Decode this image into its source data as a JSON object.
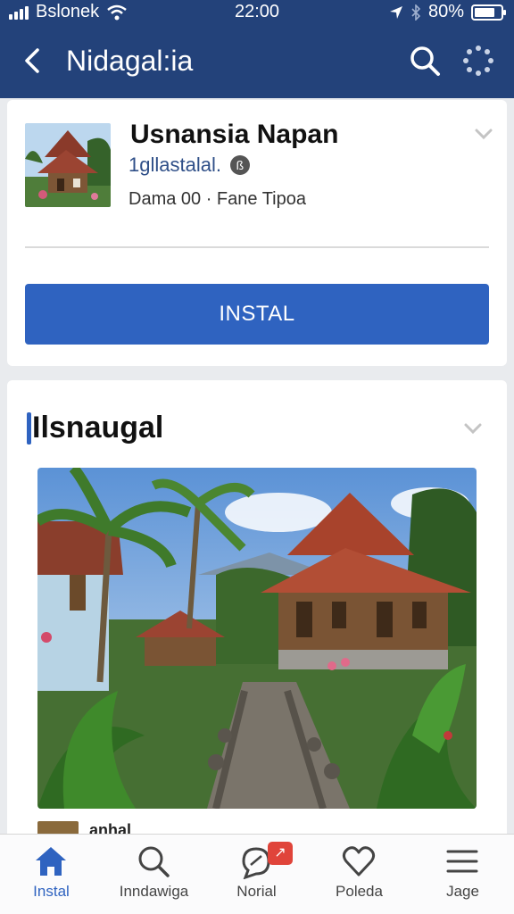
{
  "status_bar": {
    "carrier": "Bslonek",
    "time": "22:00",
    "battery": "80%",
    "battery_level": 0.8
  },
  "nav": {
    "title": "Nidagal:ia"
  },
  "app": {
    "name": "Usnansia Napan",
    "developer": "1gllastalal.",
    "developer_badge": "ß",
    "meta": "Dama 00 · Fane Tipoa",
    "install_label": "INSTAL"
  },
  "section": {
    "title": "Ilsnaugal",
    "sub_label": "anhal"
  },
  "tabs": [
    {
      "label": "Instal",
      "icon": "home-icon",
      "active": true
    },
    {
      "label": "Inndawiga",
      "icon": "search-icon",
      "active": false
    },
    {
      "label": "Norial",
      "icon": "chat-icon",
      "active": false,
      "badge": "↗"
    },
    {
      "label": "Poleda",
      "icon": "heart-icon",
      "active": false
    },
    {
      "label": "Jage",
      "icon": "menu-icon",
      "active": false
    }
  ],
  "colors": {
    "header": "#23427a",
    "accent": "#2f63c0",
    "badge": "#e0443a"
  }
}
